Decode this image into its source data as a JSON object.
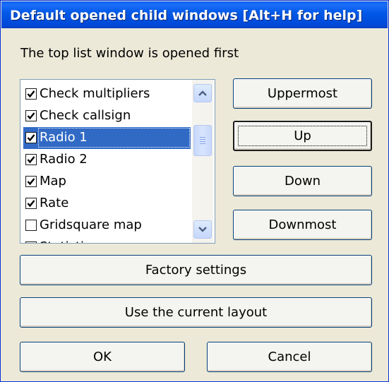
{
  "window": {
    "title": "Default opened child windows [Alt+H for help]"
  },
  "description": "The top list window is opened first",
  "list": {
    "items": [
      {
        "label": "Check multipliers",
        "checked": true,
        "selected": false
      },
      {
        "label": "Check callsign",
        "checked": true,
        "selected": false
      },
      {
        "label": "Radio 1",
        "checked": true,
        "selected": true
      },
      {
        "label": "Radio 2",
        "checked": true,
        "selected": false
      },
      {
        "label": "Map",
        "checked": true,
        "selected": false
      },
      {
        "label": "Rate",
        "checked": true,
        "selected": false
      },
      {
        "label": "Gridsquare map",
        "checked": false,
        "selected": false
      },
      {
        "label": "Statistics",
        "checked": false,
        "selected": false
      }
    ]
  },
  "buttons": {
    "uppermost": "Uppermost",
    "up": "Up",
    "down": "Down",
    "downmost": "Downmost",
    "factory_settings": "Factory settings",
    "use_current_layout": "Use the current layout",
    "ok": "OK",
    "cancel": "Cancel"
  }
}
